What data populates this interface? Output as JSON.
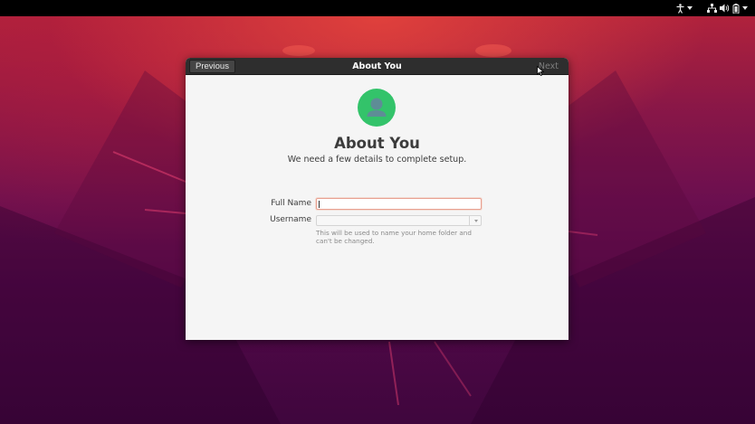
{
  "top_panel": {
    "icons": [
      "accessibility-icon",
      "network-icon",
      "volume-icon",
      "battery-icon"
    ]
  },
  "dialog": {
    "title": "About You",
    "previous_label": "Previous",
    "next_label": "Next",
    "heading": "About You",
    "subtitle": "We need a few details to complete setup.",
    "fields": {
      "full_name": {
        "label": "Full Name",
        "value": ""
      },
      "username": {
        "label": "Username",
        "value": ""
      }
    },
    "hint": "This will be used to name your home folder and can't be changed."
  },
  "colors": {
    "avatar_bg": "#33c36a",
    "headerbar": "#2e2e2e",
    "focus_border": "#e8a090"
  }
}
